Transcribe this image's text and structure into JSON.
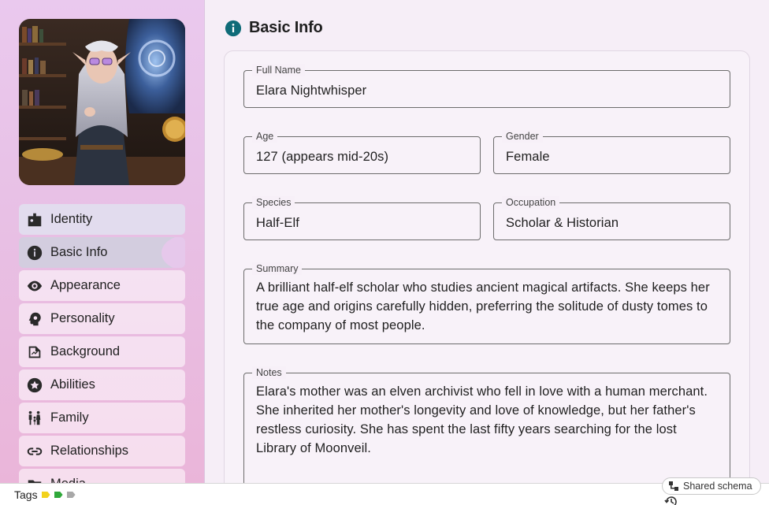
{
  "sidebar": {
    "items": [
      {
        "label": "Identity",
        "icon": "badge-icon"
      },
      {
        "label": "Basic Info",
        "icon": "info-icon"
      },
      {
        "label": "Appearance",
        "icon": "eye-icon"
      },
      {
        "label": "Personality",
        "icon": "head-gear-icon"
      },
      {
        "label": "Background",
        "icon": "history-book-icon"
      },
      {
        "label": "Abilities",
        "icon": "star-icon"
      },
      {
        "label": "Family",
        "icon": "family-icon"
      },
      {
        "label": "Relationships",
        "icon": "link-icon"
      },
      {
        "label": "Media",
        "icon": "folder-icon"
      }
    ],
    "active_index": 1
  },
  "main": {
    "title": "Basic Info",
    "fields": {
      "full_name": {
        "label": "Full Name",
        "value": "Elara Nightwhisper"
      },
      "age": {
        "label": "Age",
        "value": "127 (appears mid-20s)"
      },
      "gender": {
        "label": "Gender",
        "value": "Female"
      },
      "species": {
        "label": "Species",
        "value": "Half-Elf"
      },
      "occupation": {
        "label": "Occupation",
        "value": "Scholar & Historian"
      },
      "summary": {
        "label": "Summary",
        "value": "A brilliant half-elf scholar who studies ancient magical artifacts. She keeps her true age and origins carefully hidden, preferring the solitude of dusty tomes to the company of most people."
      },
      "notes": {
        "label": "Notes",
        "value": "Elara's mother was an elven archivist who fell in love with a human merchant. She inherited her mother's longevity and love of knowledge, but her father's restless curiosity. She has spent the last fifty years searching for the lost Library of Moonveil."
      }
    }
  },
  "bottombar": {
    "tags_label": "Tags",
    "tag_colors": [
      "#f2d21c",
      "#2fa83a",
      "#a8a8a8"
    ],
    "shared_label": "Shared schema"
  },
  "colors": {
    "accent": "#0f6b78"
  }
}
